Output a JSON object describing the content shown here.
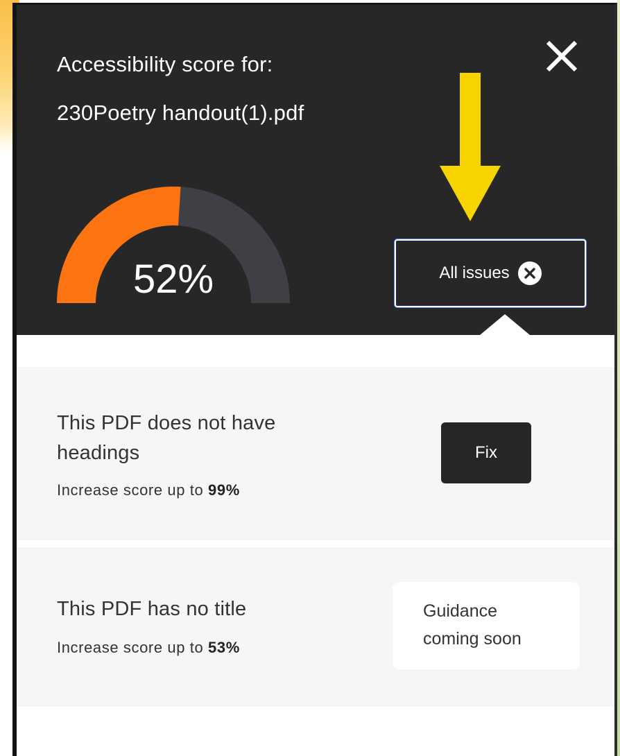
{
  "header": {
    "title_line1": "Accessibility score for:",
    "filename": "230Poetry handout(1).pdf",
    "close_icon": "close-icon",
    "background_color": "#272727"
  },
  "score": {
    "value_label": "52%",
    "fraction": 0.52,
    "fill_color": "#fc7411",
    "track_color": "#3f4045"
  },
  "annotation": {
    "arrow_icon": "arrow-down-icon",
    "arrow_color": "#f7d400"
  },
  "filter": {
    "label": "All issues",
    "clear_icon": "close-circle-icon"
  },
  "issues": [
    {
      "title": "This PDF does not have headings",
      "sub_prefix": "Increase score up to ",
      "sub_value": "99%",
      "action_label": "Fix"
    },
    {
      "title": "This PDF has no title",
      "sub_prefix": "Increase score up to ",
      "sub_value": "53%",
      "action_line1": "Guidance",
      "action_line2": "coming soon"
    }
  ]
}
